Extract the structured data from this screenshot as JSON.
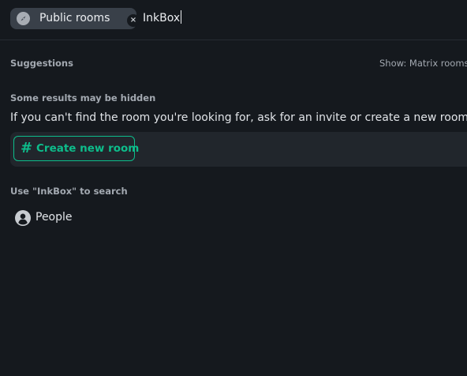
{
  "search": {
    "chip_label": "Public rooms",
    "chip_close_glyph": "×",
    "query": "InkBox"
  },
  "suggestions": {
    "title": "Suggestions",
    "show_filter": "Show: Matrix rooms"
  },
  "hidden_results": {
    "title": "Some results may be hidden",
    "hint": "If you can't find the room you're looking for, ask for an invite or create a new room.",
    "create_button_label": "Create new room",
    "hash_glyph": "#"
  },
  "use_search": {
    "title": "Use \"InkBox\" to search",
    "people_label": "People"
  },
  "colors": {
    "background": "#15191e",
    "accent": "#0dbd8b",
    "chip": "#394049",
    "card": "#21262c"
  },
  "icons": {
    "chip": "compass-icon",
    "close": "close-icon",
    "create": "hash-icon",
    "people": "person-icon"
  }
}
